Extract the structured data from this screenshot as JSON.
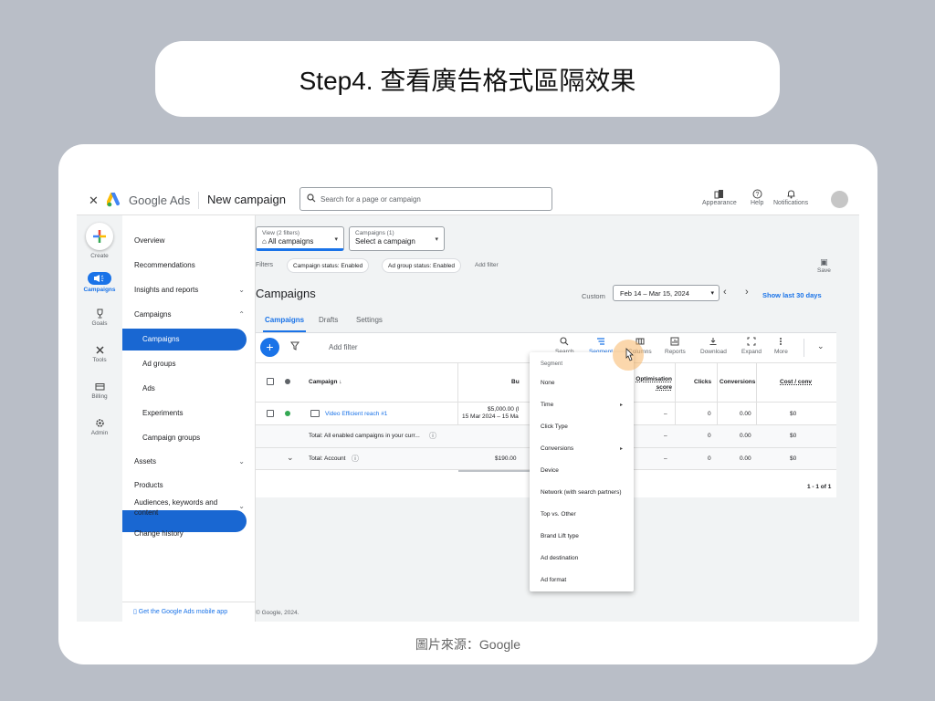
{
  "slide": {
    "title": "Step4. 查看廣告格式區隔效果",
    "caption": "圖片來源：Google"
  },
  "topbar": {
    "brand": "Google Ads",
    "page": "New campaign",
    "search_placeholder": "Search for a page or campaign",
    "actions": [
      "Appearance",
      "Help",
      "Notifications"
    ]
  },
  "rail": {
    "items": [
      "Create",
      "Campaigns",
      "Goals",
      "Tools",
      "Billing",
      "Admin"
    ]
  },
  "nav": {
    "items": [
      {
        "label": "Overview"
      },
      {
        "label": "Recommendations"
      },
      {
        "label": "Insights and reports",
        "chev": "⌄"
      },
      {
        "label": "Campaigns",
        "chev": "⌃"
      },
      {
        "label": "Campaigns"
      },
      {
        "label": "Ad groups"
      },
      {
        "label": "Ads"
      },
      {
        "label": "Experiments"
      },
      {
        "label": "Campaign groups"
      },
      {
        "label": "Assets",
        "chev": "⌄"
      },
      {
        "label": "Products"
      },
      {
        "label": "Audiences, keywords and content",
        "chev": "⌄"
      },
      {
        "label": "Change history"
      }
    ],
    "footer": "Get the Google Ads mobile app"
  },
  "main": {
    "view_label": "View (2 filters)",
    "view_value": "All campaigns",
    "campaigns_label": "Campaigns (1)",
    "campaigns_value": "Select a campaign",
    "filters_label": "Filters",
    "filter_chips": [
      "Campaign status: Enabled",
      "Ad group status: Enabled"
    ],
    "add_filter_link": "Add filter",
    "save_label": "Save",
    "heading": "Campaigns",
    "custom_label": "Custom",
    "date_range": "Feb 14 – Mar 15, 2024",
    "show_last": "Show last 30 days",
    "tabs": [
      "Campaigns",
      "Drafts",
      "Settings"
    ],
    "add_filter": "Add filter",
    "tools": [
      "Search",
      "Segment",
      "Columns",
      "Reports",
      "Download",
      "Expand",
      "More"
    ],
    "copyright": "© Google, 2024."
  },
  "table": {
    "headers": {
      "campaign": "Campaign ↓",
      "budget": "Bu",
      "opt": "Optimisation score",
      "clicks": "Clicks",
      "conversions": "Conversions",
      "cost_conv": "Cost / conv"
    },
    "row1": {
      "name": "Video Efficient reach #1",
      "budget": "$5,000.00 (l",
      "budget_dates": "15 Mar 2024 – 15 Ma",
      "opt": "–",
      "clicks": "0",
      "conversions": "0.00",
      "cost_conv": "$0"
    },
    "row2": {
      "name": "Total: All enabled campaigns in your curr...",
      "opt": "–",
      "clicks": "0",
      "conversions": "0.00",
      "cost_conv": "$0"
    },
    "row3": {
      "name": "Total: Account",
      "budget": "$190.00",
      "opt": "–",
      "clicks": "0",
      "conversions": "0.00",
      "cost_conv": "$0"
    },
    "pagination": "1 - 1 of 1"
  },
  "segment_menu": {
    "title": "Segment",
    "items": [
      {
        "label": "None",
        "arrow": ""
      },
      {
        "label": "Time",
        "arrow": "▸"
      },
      {
        "label": "Click Type",
        "arrow": ""
      },
      {
        "label": "Conversions",
        "arrow": "▸"
      },
      {
        "label": "Device",
        "arrow": ""
      },
      {
        "label": "Network (with search partners)",
        "arrow": ""
      },
      {
        "label": "Top vs. Other",
        "arrow": ""
      },
      {
        "label": "Brand Lift type",
        "arrow": ""
      },
      {
        "label": "Ad destination",
        "arrow": ""
      },
      {
        "label": "Ad format",
        "arrow": ""
      }
    ]
  },
  "colors": {
    "accent": "#1a73e8",
    "active_nav": "#1967d2",
    "status_enabled": "#34a853",
    "cursor_halo": "#f7b767"
  }
}
